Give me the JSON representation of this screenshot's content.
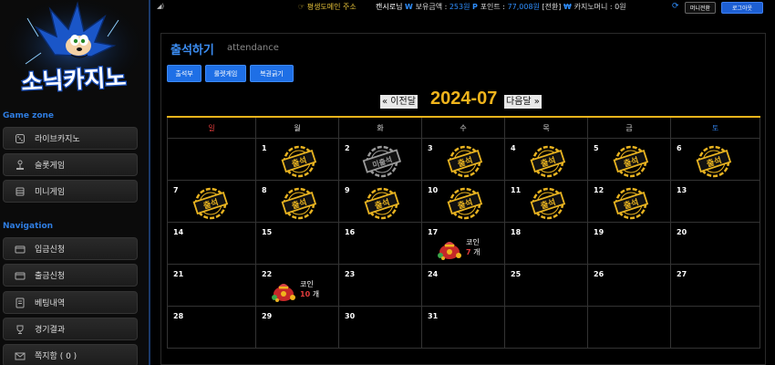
{
  "brand": {
    "logo_text": "소닉카지노"
  },
  "colors": {
    "accent": "#2f7de1",
    "gold": "#f0b41c",
    "red": "#e23b3b",
    "button_blue": "#1e6fe6"
  },
  "sidebar": {
    "sections": [
      {
        "title": "Game zone",
        "items": [
          {
            "label": "라이브카지노",
            "icon": "dice-icon"
          },
          {
            "label": "슬롯게임",
            "icon": "joystick-icon"
          },
          {
            "label": "미니게임",
            "icon": "bank-icon"
          }
        ]
      },
      {
        "title": "Navigation",
        "items": [
          {
            "label": "입금신청",
            "icon": "card-icon"
          },
          {
            "label": "출금신청",
            "icon": "card-icon"
          },
          {
            "label": "베팅내역",
            "icon": "betslip-icon"
          },
          {
            "label": "경기결과",
            "icon": "trophy-icon"
          },
          {
            "label": "쪽지함 ( 0 )",
            "icon": "mail-icon"
          }
        ]
      }
    ]
  },
  "topbar": {
    "notice": "☞ 평생도메인 주소",
    "username": "캔시로님",
    "balance_label": "보유금액 :",
    "balance_value": "253원",
    "point_label": "포인트 :",
    "point_value": "77,008원",
    "point_convert": "[전환]",
    "casino_money": "카지노머니 : 0원",
    "money_convert_button": "머니전환",
    "logout_button": "로그아웃"
  },
  "attendance": {
    "title": "출석하기",
    "subtitle": "attendance",
    "tabs": [
      "출석부",
      "룰렛게임",
      "복권긁기"
    ],
    "prev_label": "« 이전달",
    "next_label": "다음달 »",
    "month": "2024-07",
    "weekdays": [
      "일",
      "월",
      "화",
      "수",
      "목",
      "금",
      "토"
    ],
    "weekday_colors": [
      "#e23b3b",
      "#ddd",
      "#ddd",
      "#ddd",
      "#ddd",
      "#ddd",
      "#2f7de1"
    ],
    "stamp_attended": "출석",
    "stamp_missed": "미출석",
    "coin_label": "코인",
    "coin_unit": "개",
    "weeks": [
      [
        {
          "day": ""
        },
        {
          "day": "1",
          "status": "attended"
        },
        {
          "day": "2",
          "status": "missed"
        },
        {
          "day": "3",
          "status": "attended"
        },
        {
          "day": "4",
          "status": "attended"
        },
        {
          "day": "5",
          "status": "attended"
        },
        {
          "day": "6",
          "status": "attended"
        }
      ],
      [
        {
          "day": "7",
          "status": "attended"
        },
        {
          "day": "8",
          "status": "attended"
        },
        {
          "day": "9",
          "status": "attended"
        },
        {
          "day": "10",
          "status": "attended"
        },
        {
          "day": "11",
          "status": "attended"
        },
        {
          "day": "12",
          "status": "attended"
        },
        {
          "day": "13"
        }
      ],
      [
        {
          "day": "14"
        },
        {
          "day": "15"
        },
        {
          "day": "16"
        },
        {
          "day": "17",
          "coins": "7"
        },
        {
          "day": "18"
        },
        {
          "day": "19"
        },
        {
          "day": "20"
        }
      ],
      [
        {
          "day": "21"
        },
        {
          "day": "22",
          "coins": "10"
        },
        {
          "day": "23"
        },
        {
          "day": "24"
        },
        {
          "day": "25"
        },
        {
          "day": "26"
        },
        {
          "day": "27"
        }
      ],
      [
        {
          "day": "28"
        },
        {
          "day": "29"
        },
        {
          "day": "30"
        },
        {
          "day": "31"
        },
        {
          "day": ""
        },
        {
          "day": ""
        },
        {
          "day": ""
        }
      ]
    ]
  }
}
